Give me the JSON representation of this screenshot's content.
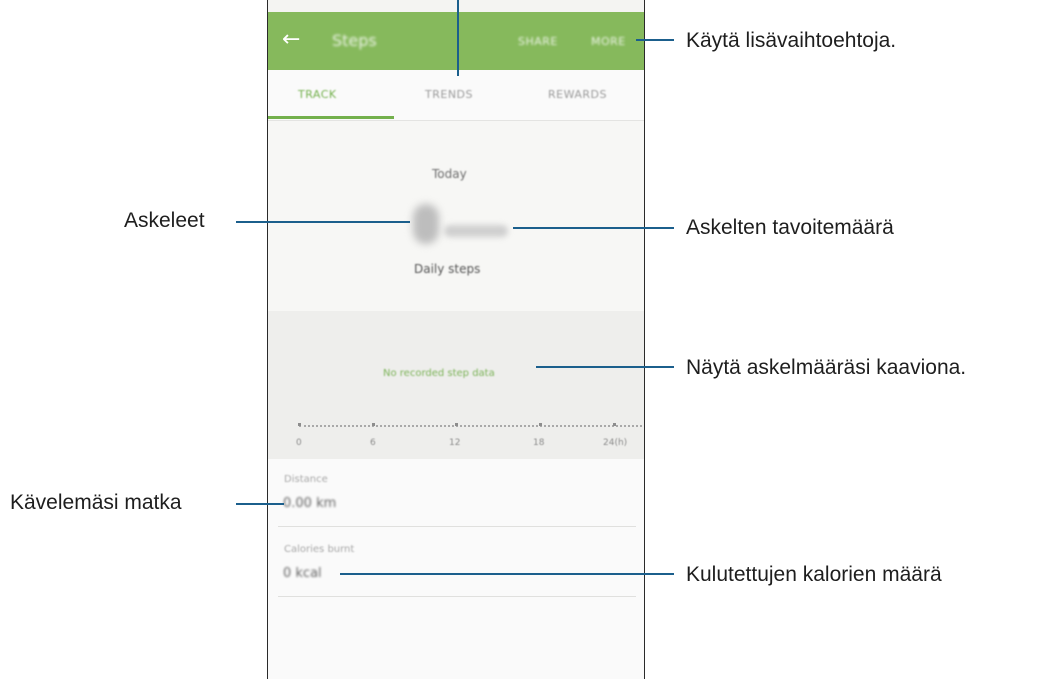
{
  "app": {
    "title": "Steps",
    "back_icon": "back-arrow-icon",
    "actions": {
      "share": "SHARE",
      "more": "MORE"
    },
    "accent_color": "#86b95c"
  },
  "tabs": [
    {
      "label": "TRACK",
      "selected": true
    },
    {
      "label": "TRENDS",
      "selected": false
    },
    {
      "label": "REWARDS",
      "selected": false
    }
  ],
  "track": {
    "heading": "Today",
    "steps_value": "0",
    "steps_goal": "/ 6000",
    "steps_label": "Daily steps",
    "no_data": "No recorded step data",
    "time_axis": [
      "0",
      "6",
      "12",
      "18",
      "24(h)"
    ]
  },
  "stats": {
    "distance_label": "Distance",
    "distance_value": "0.00 km",
    "calories_label": "Calories burnt",
    "calories_value": "0 kcal"
  },
  "callouts": {
    "more_options": "Käytä lisävaihtoehtoja.",
    "steps": "Askeleet",
    "goal": "Askelten tavoitemäärä",
    "chart": "Näytä askelmääräsi kaaviona.",
    "distance": "Kävelemäsi matka",
    "calories": "Kulutettujen kalorien määrä"
  }
}
